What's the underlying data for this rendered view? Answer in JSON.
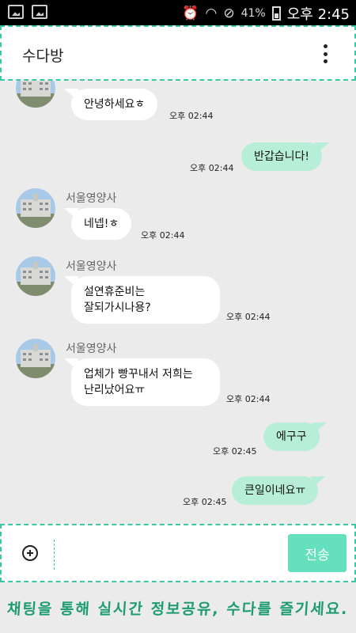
{
  "status_bar": {
    "battery": "41%",
    "time": "오후 2:45"
  },
  "header": {
    "title": "수다방"
  },
  "messages": [
    {
      "text": "안녕하세요ㅎ",
      "time": "오후 02:44"
    },
    {
      "text": "반갑습니다!",
      "time": "오후 02:44"
    },
    {
      "sender": "서울영양사",
      "text": "네넵!ㅎ",
      "time": "오후 02:44"
    },
    {
      "sender": "서울영양사",
      "line1": "설연휴준비는",
      "line2": "잘되가시나용?",
      "time": "오후 02:44"
    },
    {
      "sender": "서울영양사",
      "line1": "업체가 빵꾸내서 저희는",
      "line2": "난리났어요ㅠ",
      "time": "오후 02:44"
    },
    {
      "text": "에구구",
      "time": "오후 02:45"
    },
    {
      "text": "큰일이네요ㅠ",
      "time": "오후 02:45"
    }
  ],
  "composer": {
    "send_label": "전송"
  },
  "banner": {
    "text": "채팅을 통해 실시간 정보공유, 수다를 즐기세요."
  }
}
